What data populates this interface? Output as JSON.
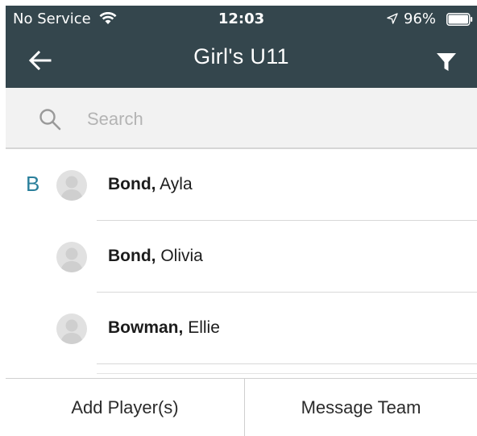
{
  "status_bar": {
    "carrier": "No Service",
    "time": "12:03",
    "battery_percent": "96%",
    "icons": [
      "wifi-icon",
      "location-icon",
      "battery-icon"
    ]
  },
  "nav": {
    "title": "Girl's U11",
    "back_icon": "arrow-left-icon",
    "filter_icon": "filter-icon"
  },
  "search": {
    "placeholder": "Search",
    "value": ""
  },
  "list": {
    "section_letter": "B",
    "players": [
      {
        "last": "Bond,",
        "first": "Ayla"
      },
      {
        "last": "Bond,",
        "first": "Olivia"
      },
      {
        "last": "Bowman,",
        "first": "Ellie"
      }
    ]
  },
  "footer": {
    "add_label": "Add Player(s)",
    "message_label": "Message Team"
  },
  "colors": {
    "header_bg": "#34464d",
    "section_letter": "#2a7f9b",
    "search_bg": "#f2f2f2"
  }
}
